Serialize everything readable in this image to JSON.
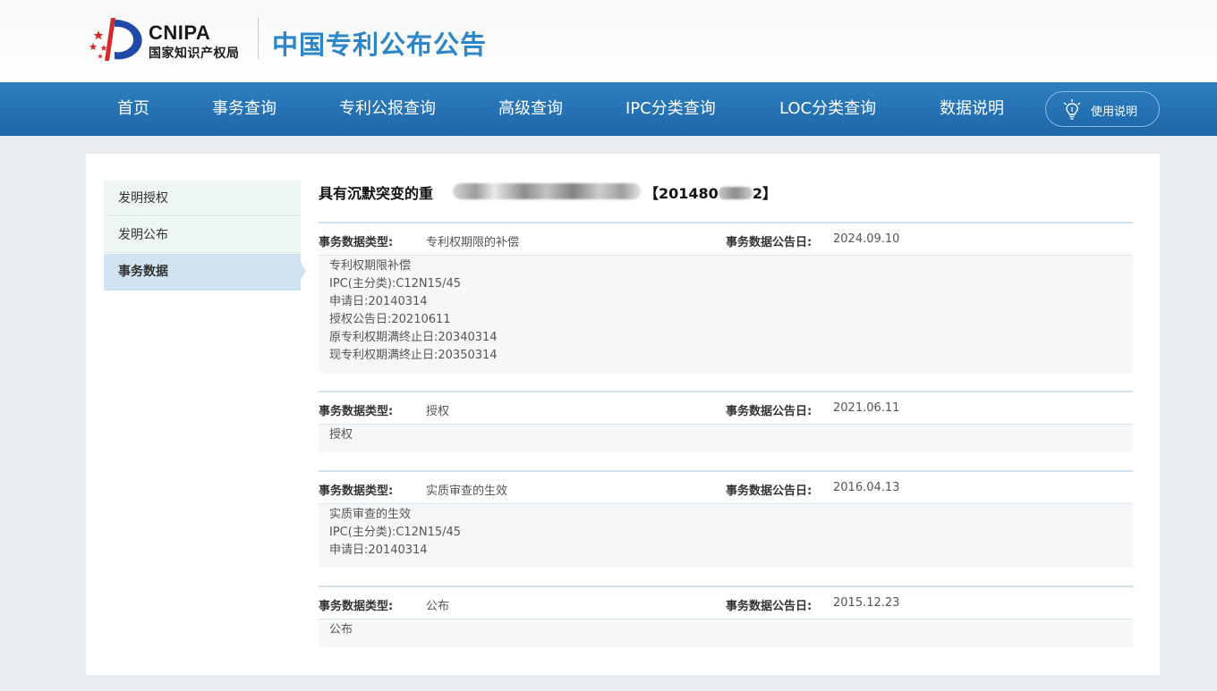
{
  "header": {
    "logo_en": "CNIPA",
    "logo_cn": "国家知识产权局",
    "site_title": "中国专利公布公告"
  },
  "nav": {
    "items": [
      "首页",
      "事务查询",
      "专利公报查询",
      "高级查询",
      "IPC分类查询",
      "LOC分类查询",
      "数据说明"
    ],
    "help_label": "使用说明",
    "help_icon": "lightbulb-icon"
  },
  "sidebar": {
    "items": [
      "发明授权",
      "发明公布",
      "事务数据"
    ],
    "active_index": 2
  },
  "patent": {
    "title_prefix": "具有沉默突变的重",
    "title_suffix": "【201480",
    "title_end": "2】"
  },
  "labels": {
    "type": "事务数据类型:",
    "date": "事务数据公告日:"
  },
  "records": [
    {
      "type": "专利权期限的补偿",
      "date": "2024.09.10",
      "lines": [
        "专利权期限补偿",
        "IPC(主分类):C12N15/45",
        "申请日:20140314",
        "授权公告日:20210611",
        "原专利权期满终止日:20340314",
        "现专利权期满终止日:20350314"
      ]
    },
    {
      "type": "授权",
      "date": "2021.06.11",
      "lines": [
        "授权"
      ]
    },
    {
      "type": "实质审查的生效",
      "date": "2016.04.13",
      "lines": [
        "实质审查的生效",
        "IPC(主分类):C12N15/45",
        "申请日:20140314"
      ]
    },
    {
      "type": "公布",
      "date": "2015.12.23",
      "lines": [
        "公布"
      ]
    }
  ],
  "colors": {
    "nav_bg": "#1d66a8",
    "title_blue": "#2d86c8",
    "sidebar_active": "#cfe3f1"
  }
}
